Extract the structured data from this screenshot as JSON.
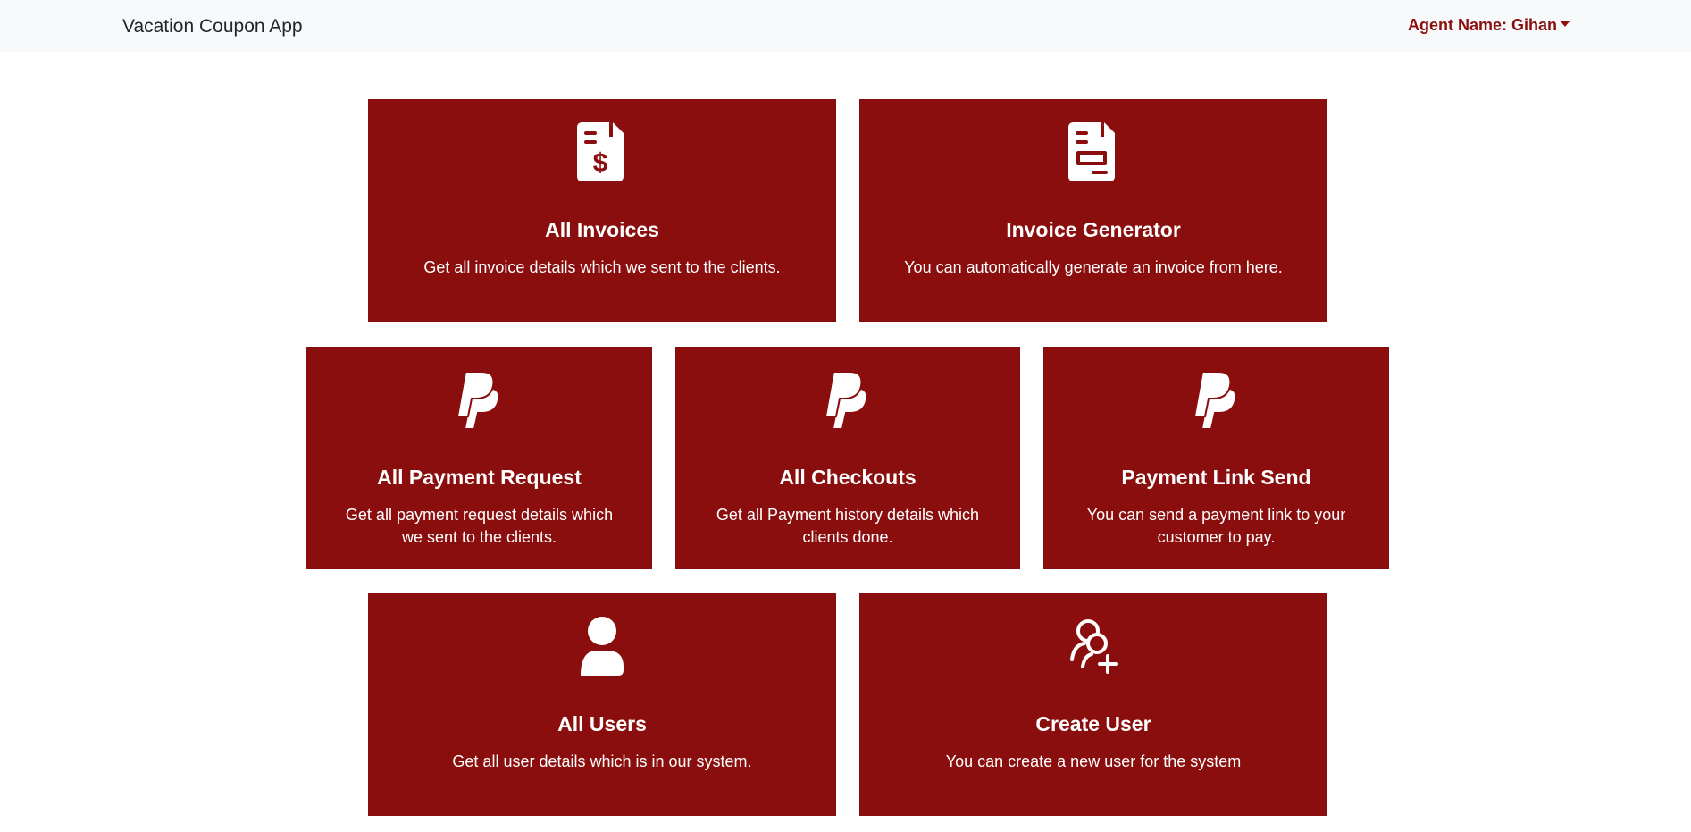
{
  "navbar": {
    "brand": "Vacation Coupon App",
    "agent_label": "Agent Name: Gihan"
  },
  "colors": {
    "card_background": "#8b0e0e",
    "navbar_background": "#f8f9fa",
    "agent_text": "#8b0f0f"
  },
  "cards": [
    {
      "icon": "invoice-dollar-icon",
      "title": "All Invoices",
      "description": "Get all invoice details which we sent to the clients."
    },
    {
      "icon": "invoice-document-icon",
      "title": "Invoice Generator",
      "description": "You can automatically generate an invoice from here."
    },
    {
      "icon": "paypal-icon",
      "title": "All Payment Request",
      "description": "Get all payment request details which we sent to the clients."
    },
    {
      "icon": "paypal-icon",
      "title": "All Checkouts",
      "description": "Get all Payment history details which clients done."
    },
    {
      "icon": "paypal-icon",
      "title": "Payment Link Send",
      "description": "You can send a payment link to your customer to pay."
    },
    {
      "icon": "user-icon",
      "title": "All Users",
      "description": "Get all user details which is in our system."
    },
    {
      "icon": "user-plus-icon",
      "title": "Create User",
      "description": "You can create a new user for the system"
    }
  ]
}
